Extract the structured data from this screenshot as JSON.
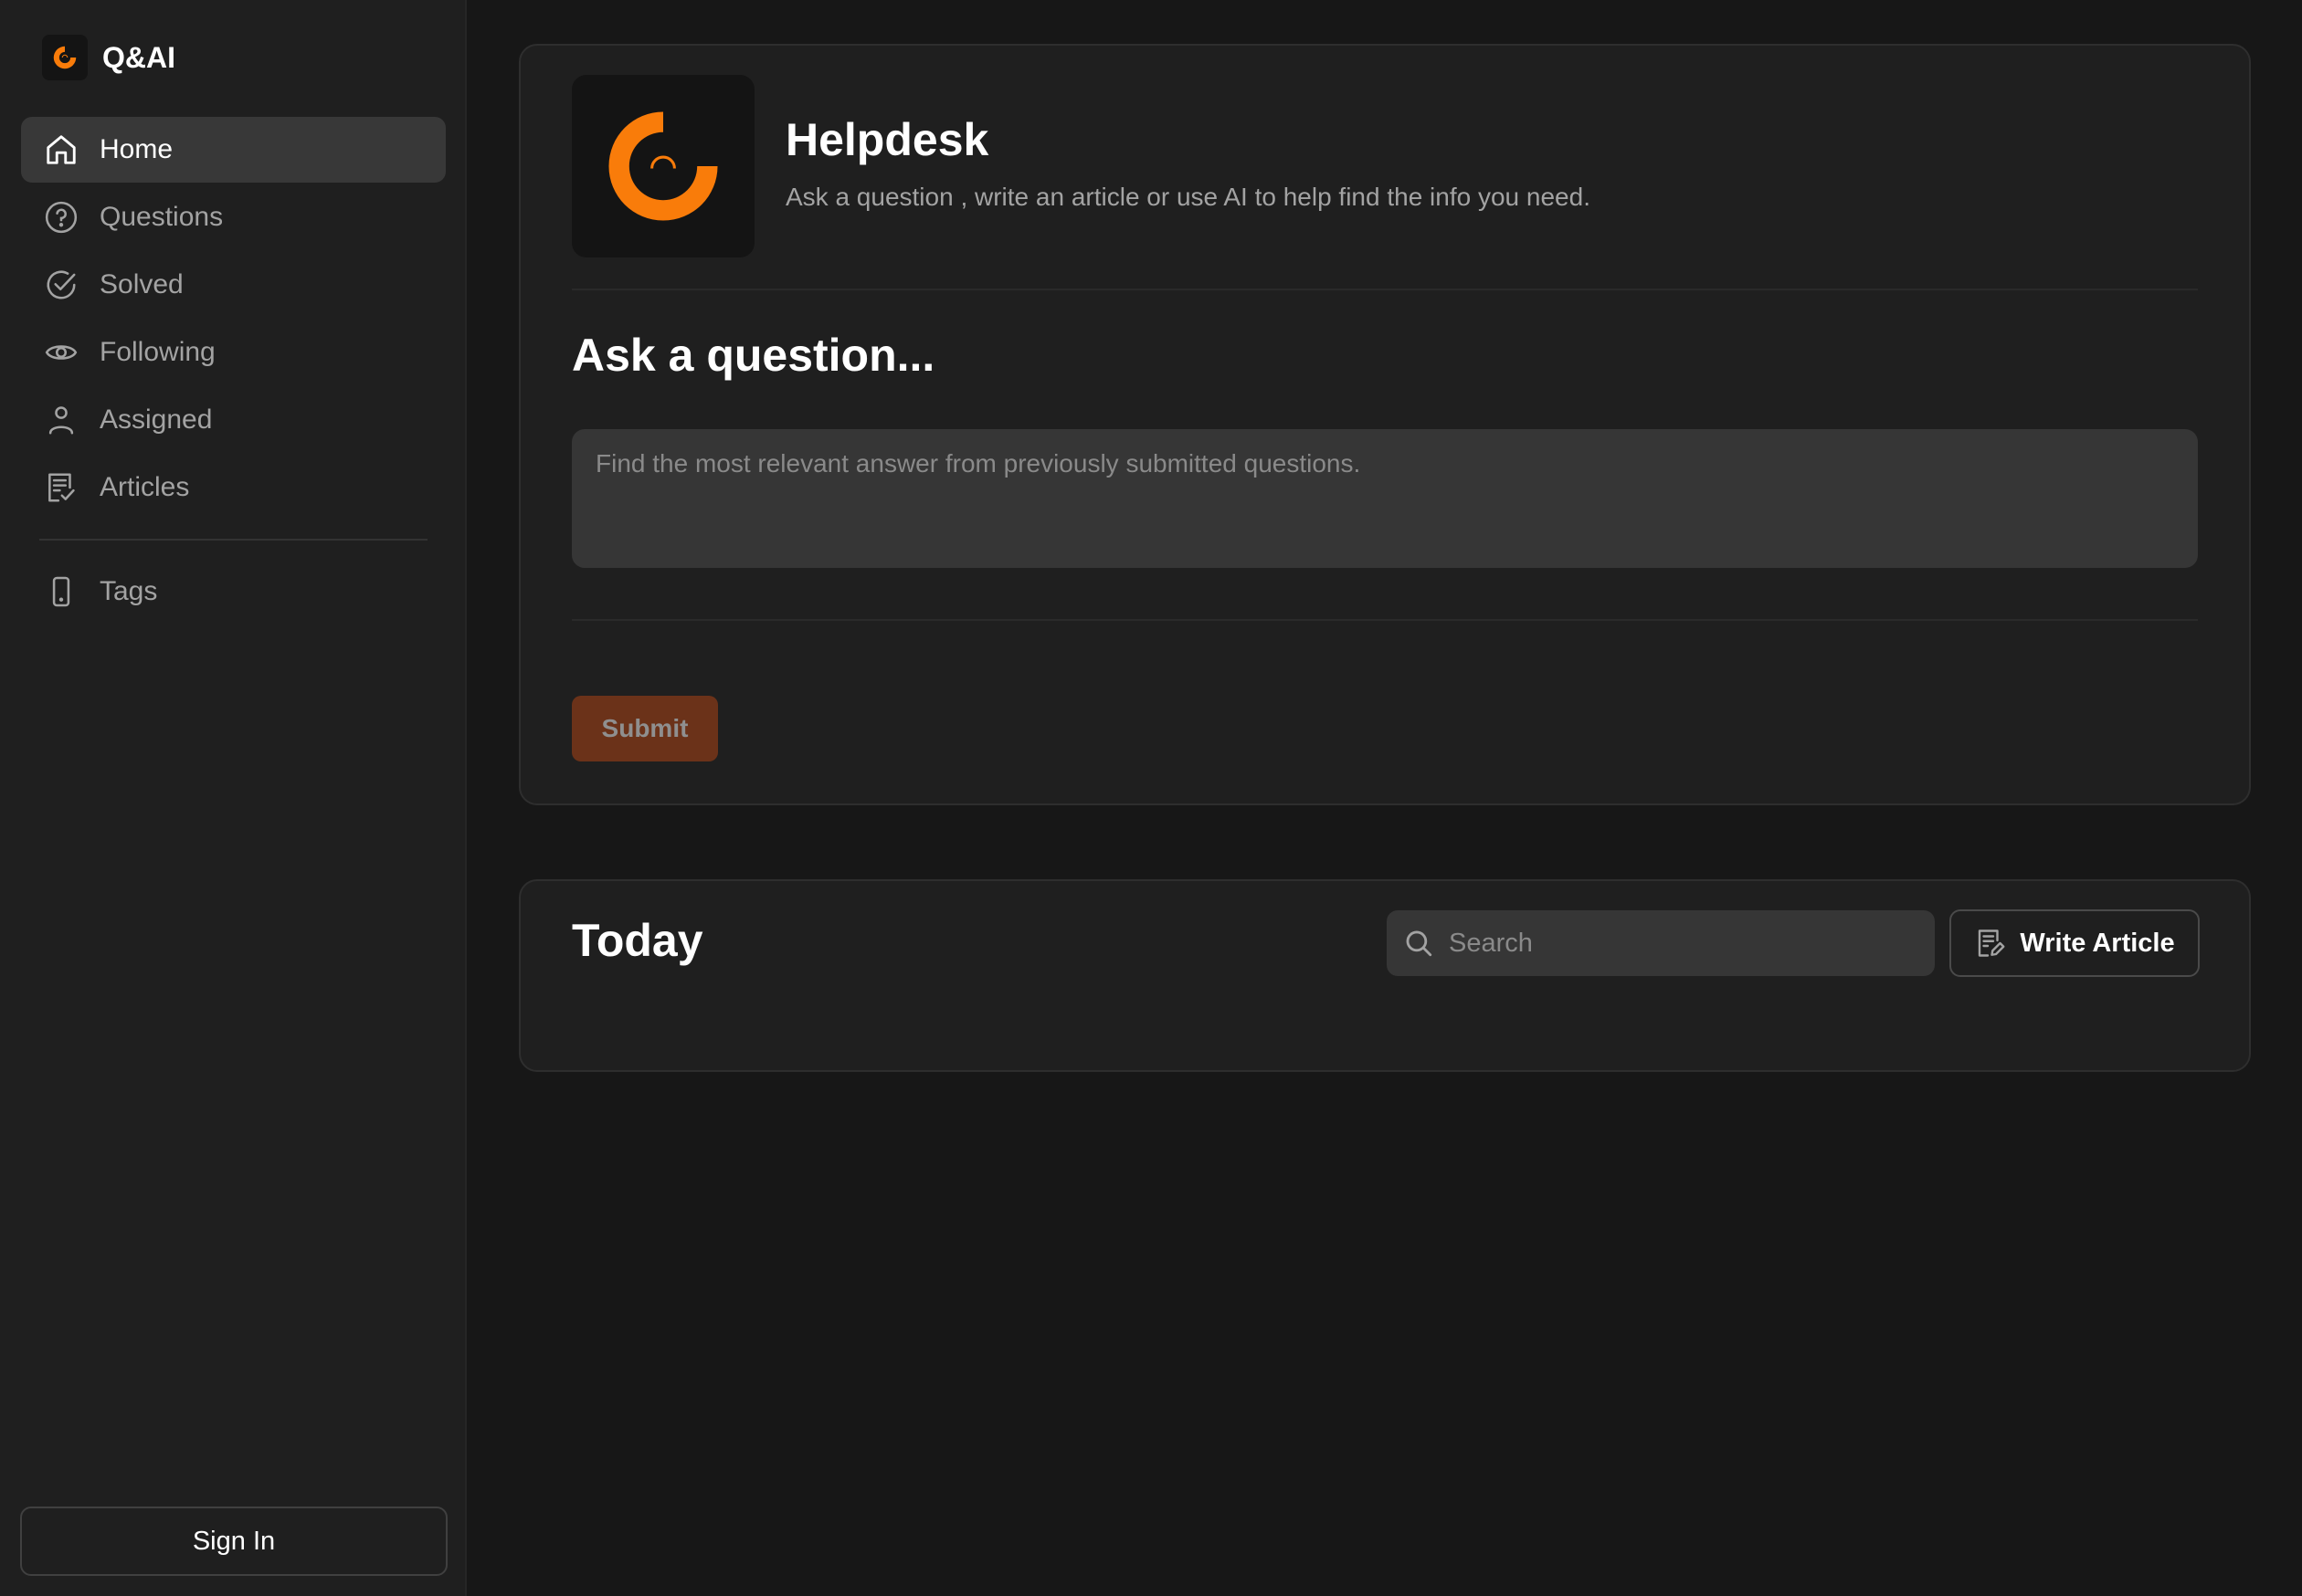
{
  "app": {
    "name": "Q&AI",
    "accent_color": "#f97c0a"
  },
  "sidebar": {
    "items": [
      {
        "label": "Home",
        "icon": "home-icon",
        "active": true
      },
      {
        "label": "Questions",
        "icon": "question-circle-icon"
      },
      {
        "label": "Solved",
        "icon": "check-circle-icon"
      },
      {
        "label": "Following",
        "icon": "eye-icon"
      },
      {
        "label": "Assigned",
        "icon": "user-icon"
      },
      {
        "label": "Articles",
        "icon": "article-check-icon"
      },
      {
        "label": "Tags",
        "icon": "mobile-icon"
      }
    ],
    "sign_in_label": "Sign In"
  },
  "helpdesk": {
    "title": "Helpdesk",
    "subtitle": "Ask a question , write an article or use AI to help find the info you need.",
    "ask_title": "Ask a question...",
    "ask_placeholder": "Find the most relevant answer from previously submitted questions.",
    "submit_label": "Submit"
  },
  "today": {
    "title": "Today",
    "search_placeholder": "Search",
    "write_article_label": "Write Article"
  }
}
